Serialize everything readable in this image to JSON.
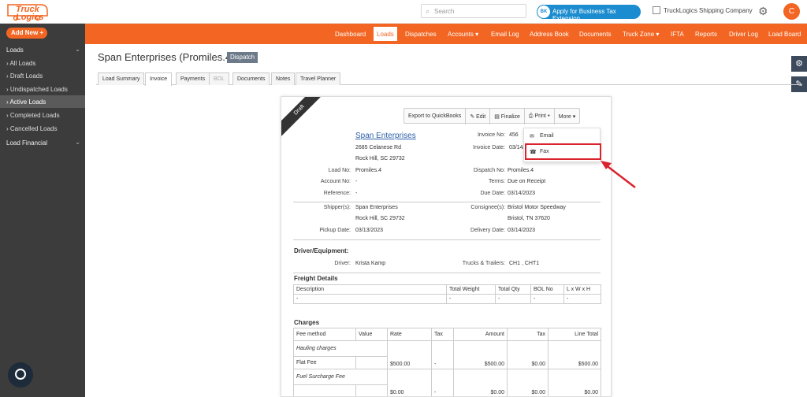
{
  "topbar": {
    "logo": "Truck Logics",
    "search_placeholder": "Search",
    "apply_badge": "BK",
    "apply_label": "Apply for Business Tax Extension",
    "company": "TruckLogics Shipping Company",
    "avatar": "C"
  },
  "sidebar": {
    "add_new": "Add New",
    "loads_section": "Loads",
    "items": [
      "All Loads",
      "Draft Loads",
      "Undispatched Loads",
      "Active Loads",
      "Completed Loads",
      "Cancelled Loads"
    ],
    "load_financial": "Load Financial"
  },
  "nav": [
    "Dashboard",
    "Loads",
    "Dispatches",
    "Accounts",
    "Email Log",
    "Address Book",
    "Documents",
    "Truck Zone",
    "IFTA",
    "Reports",
    "Driver Log",
    "Load Board"
  ],
  "page": {
    "title": "Span Enterprises (Promiles.4)",
    "status": "Dispatch"
  },
  "tabs": [
    "Load Summary",
    "Invoice",
    "Payments",
    "BOL",
    "Documents",
    "Notes",
    "Travel Planner"
  ],
  "toolbar": {
    "ribbon": "Draft",
    "export": "Export to QuickBooks",
    "edit": "Edit",
    "finalize": "Finalize",
    "print": "Print",
    "more": "More",
    "menu_email": "Email",
    "menu_fax": "Fax"
  },
  "invoice": {
    "company_name": "Span Enterprises",
    "address1": "2685 Celanese Rd",
    "address2": "Rock Hill, SC 29732",
    "invoice_no_label": "Invoice No:",
    "invoice_no": "456",
    "invoice_date_label": "Invoice Date:",
    "invoice_date": "03/14/2",
    "load_no_label": "Load No:",
    "load_no": "Promiles.4",
    "account_no_label": "Account No:",
    "account_no": "-",
    "reference_label": "Reference:",
    "reference": "-",
    "dispatch_no_label": "Dispatch No:",
    "dispatch_no": "Promiles.4",
    "terms_label": "Terms:",
    "terms": "Due on Receipt",
    "due_date_label": "Due Date:",
    "due_date": "03/14/2023",
    "shipper_label": "Shipper(s):",
    "shipper_name": "Span Enterprises",
    "shipper_city": "Rock Hill, SC 29732",
    "consignee_label": "Consignee(s):",
    "consignee_name": "Bristol Motor Speedway",
    "consignee_city": "Bristol, TN 37620",
    "pickup_label": "Pickup Date:",
    "pickup_date": "03/13/2023",
    "delivery_label": "Delivery Date:",
    "delivery_date": "03/14/2023",
    "driver_equipment_title": "Driver/Equipment:",
    "driver_label": "Driver:",
    "driver": "Krista Kamp",
    "trucks_label": "Trucks & Trailers:",
    "trucks": "CH1 , CHT1",
    "freight_title": "Freight Details",
    "freight_headers": [
      "Description",
      "Total Weight",
      "Total Qty",
      "BOL No",
      "L x W x H"
    ],
    "freight_row": [
      "-",
      "-",
      "-",
      "-",
      "-"
    ],
    "charges_title": "Charges",
    "charges_headers": [
      "Fee method",
      "Value",
      "Rate",
      "Tax",
      "Amount",
      "Tax",
      "Line Total"
    ],
    "hauling_label": "Hauling charges",
    "hauling_row": [
      "Flat Fee",
      "",
      "$500.00",
      "-",
      "$500.00",
      "$0.00",
      "$500.00"
    ],
    "fuel_label": "Fuel Surcharge Fee",
    "fuel_row": [
      "",
      "",
      "$0.00",
      "-",
      "$0.00",
      "$0.00",
      "$0.00"
    ]
  },
  "colors": {
    "brand_orange": "#f26522",
    "sidebar_bg": "#3c3c3c",
    "highlight_red": "#d9232d",
    "link_blue": "#2b5fa6"
  }
}
